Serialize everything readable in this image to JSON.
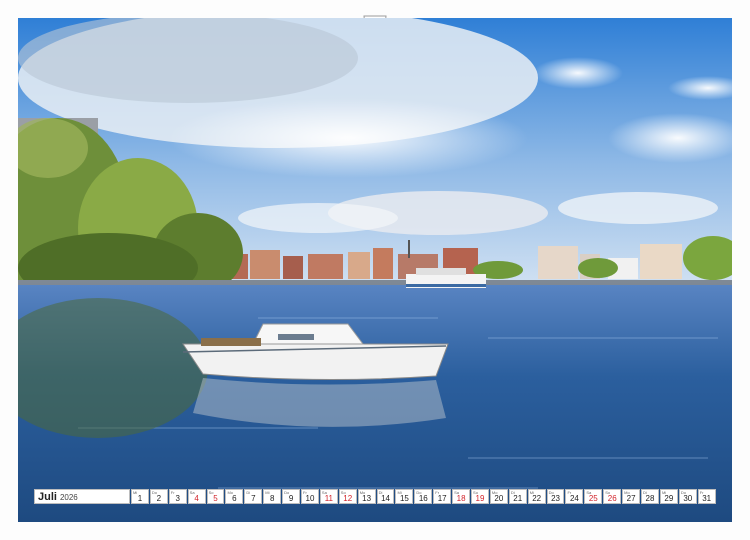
{
  "calendar": {
    "month": "Juli",
    "year": "2026",
    "days": [
      {
        "num": "1",
        "wd": "Mi",
        "weekend": false
      },
      {
        "num": "2",
        "wd": "Do",
        "weekend": false
      },
      {
        "num": "3",
        "wd": "Fr",
        "weekend": false
      },
      {
        "num": "4",
        "wd": "Sa",
        "weekend": true
      },
      {
        "num": "5",
        "wd": "So",
        "weekend": true
      },
      {
        "num": "6",
        "wd": "Mo",
        "weekend": false
      },
      {
        "num": "7",
        "wd": "Di",
        "weekend": false
      },
      {
        "num": "8",
        "wd": "Mi",
        "weekend": false
      },
      {
        "num": "9",
        "wd": "Do",
        "weekend": false
      },
      {
        "num": "10",
        "wd": "Fr",
        "weekend": false
      },
      {
        "num": "11",
        "wd": "Sa",
        "weekend": true
      },
      {
        "num": "12",
        "wd": "So",
        "weekend": true
      },
      {
        "num": "13",
        "wd": "Mo",
        "weekend": false
      },
      {
        "num": "14",
        "wd": "Di",
        "weekend": false
      },
      {
        "num": "15",
        "wd": "Mi",
        "weekend": false
      },
      {
        "num": "16",
        "wd": "Do",
        "weekend": false
      },
      {
        "num": "17",
        "wd": "Fr",
        "weekend": false
      },
      {
        "num": "18",
        "wd": "Sa",
        "weekend": true
      },
      {
        "num": "19",
        "wd": "So",
        "weekend": true
      },
      {
        "num": "20",
        "wd": "Mo",
        "weekend": false
      },
      {
        "num": "21",
        "wd": "Di",
        "weekend": false
      },
      {
        "num": "22",
        "wd": "Mi",
        "weekend": false
      },
      {
        "num": "23",
        "wd": "Do",
        "weekend": false
      },
      {
        "num": "24",
        "wd": "Fr",
        "weekend": false
      },
      {
        "num": "25",
        "wd": "Sa",
        "weekend": true
      },
      {
        "num": "26",
        "wd": "So",
        "weekend": true
      },
      {
        "num": "27",
        "wd": "Mo",
        "weekend": false
      },
      {
        "num": "28",
        "wd": "Di",
        "weekend": false
      },
      {
        "num": "29",
        "wd": "Mi",
        "weekend": false
      },
      {
        "num": "30",
        "wd": "Do",
        "weekend": false
      },
      {
        "num": "31",
        "wd": "Fr",
        "weekend": false
      }
    ]
  },
  "colors": {
    "sky_top": "#2f7fd6",
    "water": "#2b5f9e",
    "weekend_red": "#d2232a"
  }
}
